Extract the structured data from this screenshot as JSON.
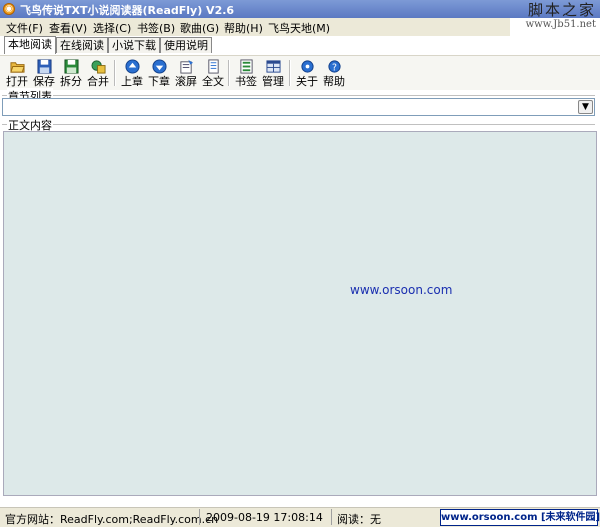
{
  "window": {
    "title": "飞鸟传说TXT小说阅读器(ReadFly) V2.6"
  },
  "watermark": {
    "site_cn": "脚本之家",
    "site_url": "www.Jb51.net"
  },
  "menu": [
    "文件(F)",
    "查看(V)",
    "选择(C)",
    "书签(B)",
    "歌曲(G)",
    "帮助(H)",
    "飞鸟天地(M)"
  ],
  "tabs": [
    "本地阅读",
    "在线阅读",
    "小说下载",
    "使用说明"
  ],
  "toolbar": [
    "打开",
    "保存",
    "拆分",
    "合并",
    "上章",
    "下章",
    "滚屏",
    "全文",
    "书签",
    "管理",
    "关于",
    "帮助"
  ],
  "chapter_list": {
    "label": "章节列表",
    "value": ""
  },
  "content": {
    "label": "正文内容",
    "watermark": "www.orsoon.com"
  },
  "status": {
    "site": "官方网站：ReadFly.com;ReadFly.com.cn",
    "datetime": "2009-08-19 17:08:14",
    "reading": "阅读：无",
    "brand": "www.orsoon.com [未来软件园]"
  }
}
